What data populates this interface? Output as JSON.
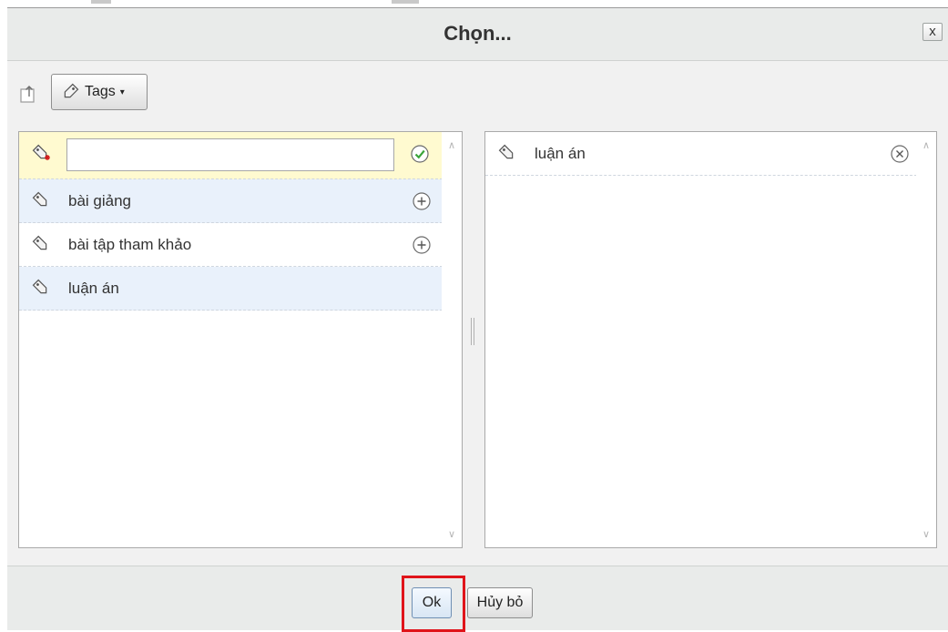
{
  "dialog": {
    "title": "Chọn...",
    "close_label": "x"
  },
  "toolbar": {
    "export_icon": "export-icon",
    "tags_label": "Tags",
    "tags_icon": "tag-icon",
    "caret": "▾"
  },
  "left_panel": {
    "new_tag_placeholder": "",
    "new_tag_value": "",
    "items": [
      {
        "label": "bài giảng",
        "action": "add"
      },
      {
        "label": "bài tập tham khảo",
        "action": "add"
      },
      {
        "label": "luận án",
        "action": "none"
      }
    ]
  },
  "right_panel": {
    "items": [
      {
        "label": "luận án",
        "action": "remove"
      }
    ]
  },
  "footer": {
    "ok_label": "Ok",
    "cancel_label": "Hủy bỏ"
  },
  "colors": {
    "highlight_border": "#e0141a",
    "new_row_bg": "#fffad0",
    "alt_row_bg": "#e9f1fb",
    "confirm_green": "#3aa53a"
  }
}
